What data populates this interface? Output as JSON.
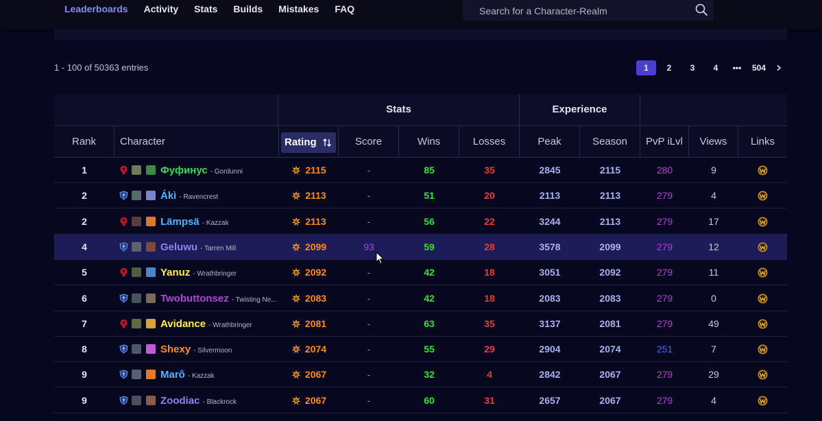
{
  "nav": {
    "items": [
      {
        "label": "Leaderboards",
        "active": true
      },
      {
        "label": "Activity",
        "active": false
      },
      {
        "label": "Stats",
        "active": false
      },
      {
        "label": "Builds",
        "active": false
      },
      {
        "label": "Mistakes",
        "active": false
      },
      {
        "label": "FAQ",
        "active": false
      }
    ],
    "search_placeholder": "Search for a Character-Realm"
  },
  "summary": "1 - 100 of 50363 entries",
  "pagination": {
    "pages": [
      "1",
      "2",
      "3",
      "4",
      "•••",
      "504"
    ],
    "active": "1",
    "next_icon": "chevron-right-icon"
  },
  "table": {
    "groups": {
      "stats": "Stats",
      "experience": "Experience"
    },
    "headers": {
      "rank": "Rank",
      "character": "Character",
      "rating": "Rating",
      "score": "Score",
      "wins": "Wins",
      "losses": "Losses",
      "peak": "Peak",
      "season": "Season",
      "ilvl": "PvP iLvl",
      "views": "Views",
      "links": "Links"
    },
    "rows": [
      {
        "rank": "1",
        "name": "Фуфинус",
        "realm": "- Gordunni",
        "faction": "horde",
        "name_color": "#33dd55",
        "rating": "2115",
        "score": "-",
        "wins": "85",
        "losses": "35",
        "peak": "2845",
        "season": "2115",
        "ilvl": "280",
        "views": "9",
        "highlight": false
      },
      {
        "rank": "2",
        "name": "Ákì",
        "realm": "- Ravencrest",
        "faction": "alliance",
        "name_color": "#4fb3ff",
        "rating": "2113",
        "score": "-",
        "wins": "51",
        "losses": "20",
        "peak": "2113",
        "season": "2113",
        "ilvl": "279",
        "views": "4",
        "highlight": false
      },
      {
        "rank": "2",
        "name": "Lämpsä",
        "realm": "- Kazzak",
        "faction": "horde",
        "name_color": "#4fb3ff",
        "rating": "2113",
        "score": "-",
        "wins": "56",
        "losses": "22",
        "peak": "3244",
        "season": "2113",
        "ilvl": "279",
        "views": "17",
        "highlight": false
      },
      {
        "rank": "4",
        "name": "Geluwu",
        "realm": "- Tarren Mill",
        "faction": "alliance",
        "name_color": "#8787ed",
        "rating": "2099",
        "score": "93",
        "wins": "59",
        "losses": "28",
        "peak": "3578",
        "season": "2099",
        "ilvl": "279",
        "views": "12",
        "highlight": true
      },
      {
        "rank": "5",
        "name": "Yanuz",
        "realm": "- Wrathbringer",
        "faction": "horde",
        "name_color": "#fff04a",
        "rating": "2092",
        "score": "-",
        "wins": "42",
        "losses": "18",
        "peak": "3051",
        "season": "2092",
        "ilvl": "279",
        "views": "11",
        "highlight": false
      },
      {
        "rank": "6",
        "name": "Twobuttonsez",
        "realm": "- Twisting Ne...",
        "faction": "alliance",
        "name_color": "#b542d9",
        "rating": "2083",
        "score": "-",
        "wins": "42",
        "losses": "18",
        "peak": "2083",
        "season": "2083",
        "ilvl": "279",
        "views": "0",
        "highlight": false
      },
      {
        "rank": "7",
        "name": "Avidance",
        "realm": "- Wrathbringer",
        "faction": "horde",
        "name_color": "#fff04a",
        "rating": "2081",
        "score": "-",
        "wins": "63",
        "losses": "35",
        "peak": "3137",
        "season": "2081",
        "ilvl": "279",
        "views": "49",
        "highlight": false
      },
      {
        "rank": "8",
        "name": "Shexy",
        "realm": "- Silvermoon",
        "faction": "alliance",
        "name_color": "#ff8c1a",
        "rating": "2074",
        "score": "-",
        "wins": "55",
        "losses": "29",
        "peak": "2904",
        "season": "2074",
        "ilvl": "251",
        "views": "7",
        "highlight": false
      },
      {
        "rank": "9",
        "name": "Marô",
        "realm": "- Kazzak",
        "faction": "alliance",
        "name_color": "#4fb3ff",
        "rating": "2067",
        "score": "-",
        "wins": "32",
        "losses": "4",
        "peak": "2842",
        "season": "2067",
        "ilvl": "279",
        "views": "29",
        "highlight": false
      },
      {
        "rank": "9",
        "name": "Zoodiac",
        "realm": "- Blackrock",
        "faction": "alliance",
        "name_color": "#8787ed",
        "rating": "2067",
        "score": "-",
        "wins": "60",
        "losses": "31",
        "peak": "2657",
        "season": "2067",
        "ilvl": "279",
        "views": "4",
        "highlight": false
      }
    ]
  },
  "colors": {
    "accent": "#4b3fd0",
    "rating": "#ff8c1a",
    "wins": "#2ee52e",
    "losses": "#ef3a3a",
    "ilvl_purple": "#b23fe0",
    "ilvl_blue": "#3b6ef0"
  }
}
